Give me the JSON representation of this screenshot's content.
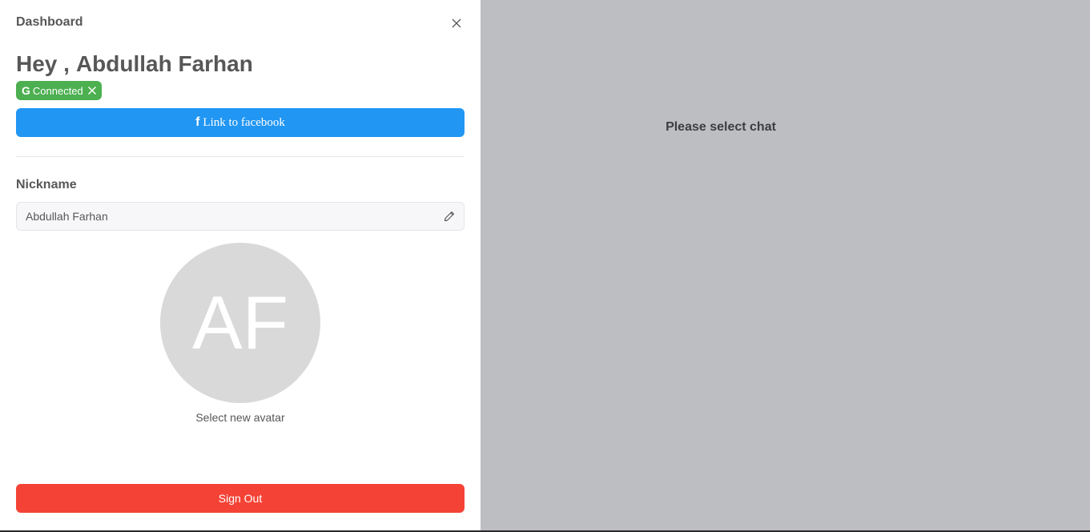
{
  "drawer": {
    "title": "Dashboard",
    "close_icon": "close-icon",
    "greeting_prefix": "Hey ,",
    "user_name": "Abdullah Farhan",
    "google_tag": {
      "icon": "google-icon",
      "label": "Connected",
      "remove_icon": "close-icon"
    },
    "facebook_button": {
      "icon": "facebook-icon",
      "label": "Link to facebook"
    },
    "nickname": {
      "label": "Nickname",
      "value": "Abdullah Farhan",
      "edit_icon": "pencil-icon"
    },
    "avatar": {
      "initials": "AF",
      "select_label": "Select new avatar"
    },
    "sign_out_label": "Sign Out"
  },
  "main": {
    "placeholder": "Please select chat"
  },
  "colors": {
    "google_tag": "#4caf50",
    "facebook": "#2196f3",
    "sign_out": "#f44336",
    "overlay": "#bdbec2"
  }
}
